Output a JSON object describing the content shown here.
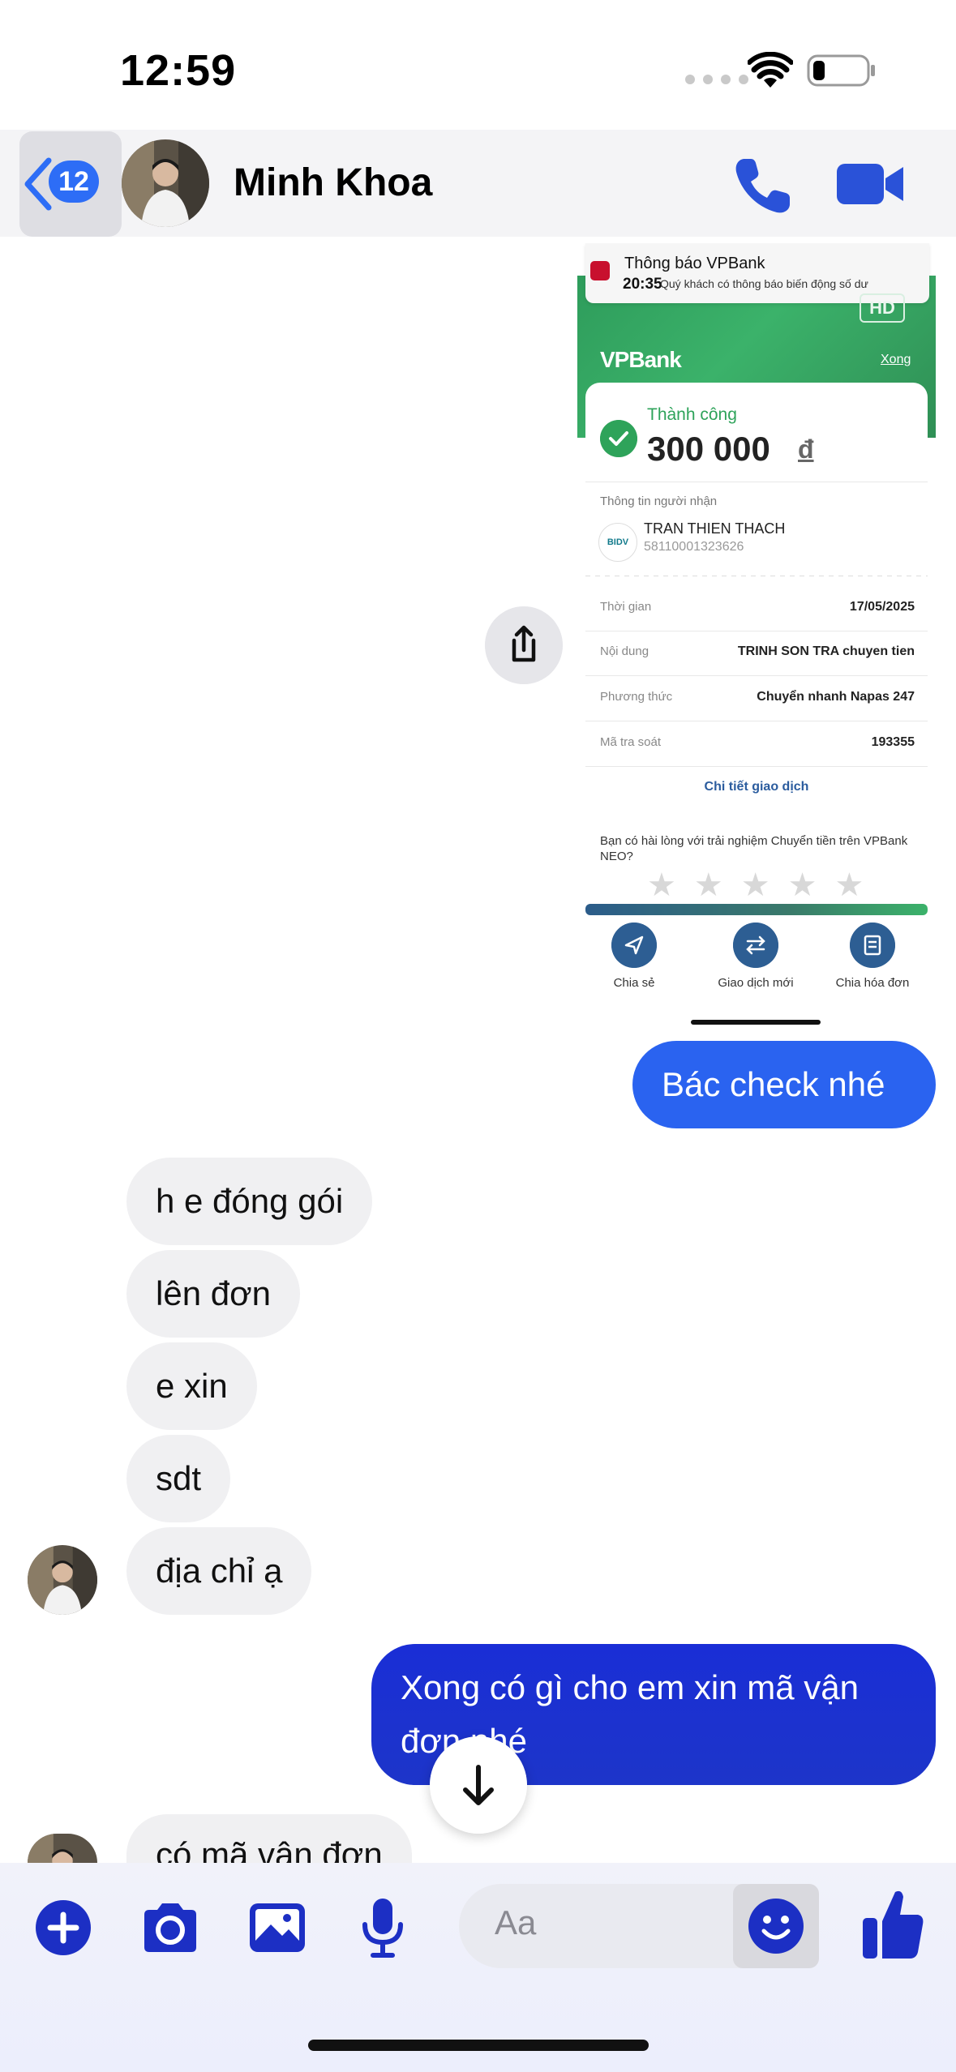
{
  "status_bar": {
    "time": "12:59"
  },
  "header": {
    "back_badge": "12",
    "contact_name": "Minh Khoa"
  },
  "shared_image": {
    "notification": {
      "title": "Thông báo VPBank",
      "time": "20:35",
      "body": "Quý khách có thông báo biến động số dư"
    },
    "hd_badge": "HD",
    "logo": "VPBank",
    "done": "Xong",
    "status": "Thành công",
    "amount": "300 000",
    "currency": "đ",
    "recipient_label": "Thông tin người nhận",
    "bank_code": "BIDV",
    "recipient_name": "TRAN THIEN THACH",
    "recipient_account": "58110001323626",
    "rows": [
      {
        "label": "Thời gian",
        "value": "17/05/2025"
      },
      {
        "label": "Nội dung",
        "value": "TRINH SON TRA chuyen tien"
      },
      {
        "label": "Phương thức",
        "value": "Chuyển nhanh Napas 247"
      },
      {
        "label": "Mã tra soát",
        "value": "193355"
      }
    ],
    "detail_link": "Chi tiết giao dịch",
    "rating_question": "Bạn có hài lòng với trải nghiệm Chuyển tiền trên VPBank NEO?",
    "actions": [
      "Chia sẻ",
      "Giao dịch mới",
      "Chia hóa đơn"
    ]
  },
  "messages": {
    "out_1": "Bác check nhé",
    "in_1": "h e đóng gói",
    "in_2": "lên đơn",
    "in_3": "e xin",
    "in_4": "sdt",
    "in_5": "địa chỉ ạ",
    "out_2": "Xong có gì cho em xin mã vận đơn nhé",
    "in_6": "có mã vận đơn"
  },
  "composer": {
    "placeholder": "Aa"
  },
  "colors": {
    "accent": "#2a63f0",
    "dark_blue": "#1a2ed6",
    "icon_blue": "#1c2fc4",
    "vp_green": "#3bb26a"
  }
}
